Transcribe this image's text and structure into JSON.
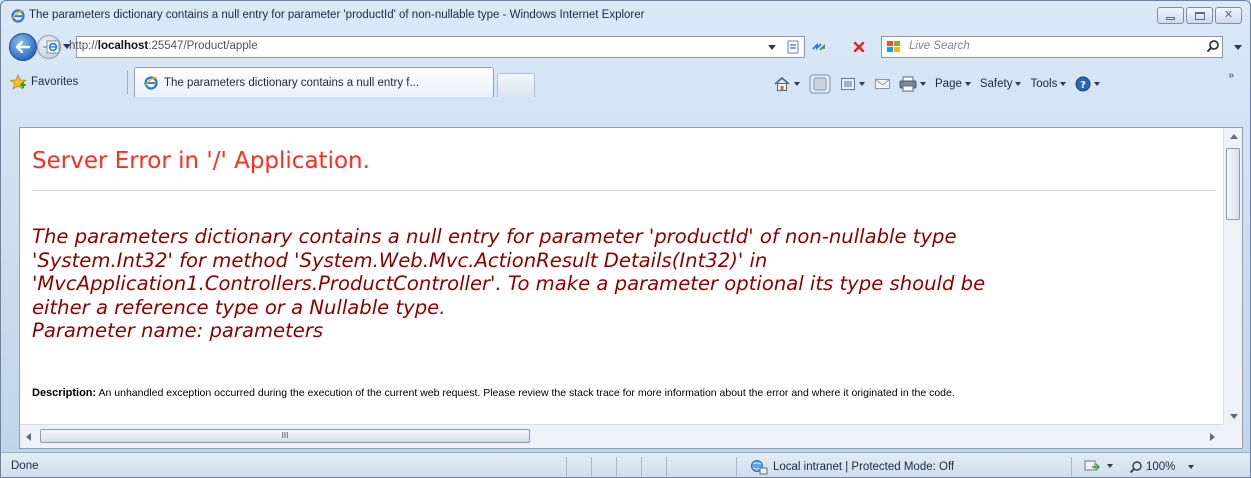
{
  "window": {
    "title": "The parameters dictionary contains a null entry for parameter 'productId' of non-nullable type  - Windows Internet Explorer"
  },
  "address_bar": {
    "url_prefix": "http://",
    "url_host": "localhost",
    "url_rest": ":25547/Product/apple"
  },
  "search": {
    "placeholder": "Live Search"
  },
  "favorites": {
    "label": "Favorites"
  },
  "tabs": [
    {
      "label": "The parameters dictionary contains a null entry f..."
    }
  ],
  "command_bar": {
    "page": "Page",
    "safety": "Safety",
    "tools": "Tools"
  },
  "content": {
    "title": "Server Error in '/' Application.",
    "error_lines": [
      "The parameters dictionary contains a null entry for parameter 'productId' of non-nullable type",
      "'System.Int32' for method 'System.Web.Mvc.ActionResult Details(Int32)' in",
      "'MvcApplication1.Controllers.ProductController'. To make a parameter optional its type should be",
      "either a reference type or a Nullable type.",
      "Parameter name: parameters"
    ],
    "description_label": "Description:",
    "description_text": " An unhandled exception occurred during the execution of the current web request. Please review the stack trace for more information about the error and where it originated in the code."
  },
  "scrollbar": {
    "grip": "III"
  },
  "status_bar": {
    "status": "Done",
    "zone": "Local intranet | Protected Mode: Off",
    "zoom": "100%"
  },
  "colors": {
    "error_title": "#ff2d1d",
    "error_message": "#8e0000"
  }
}
